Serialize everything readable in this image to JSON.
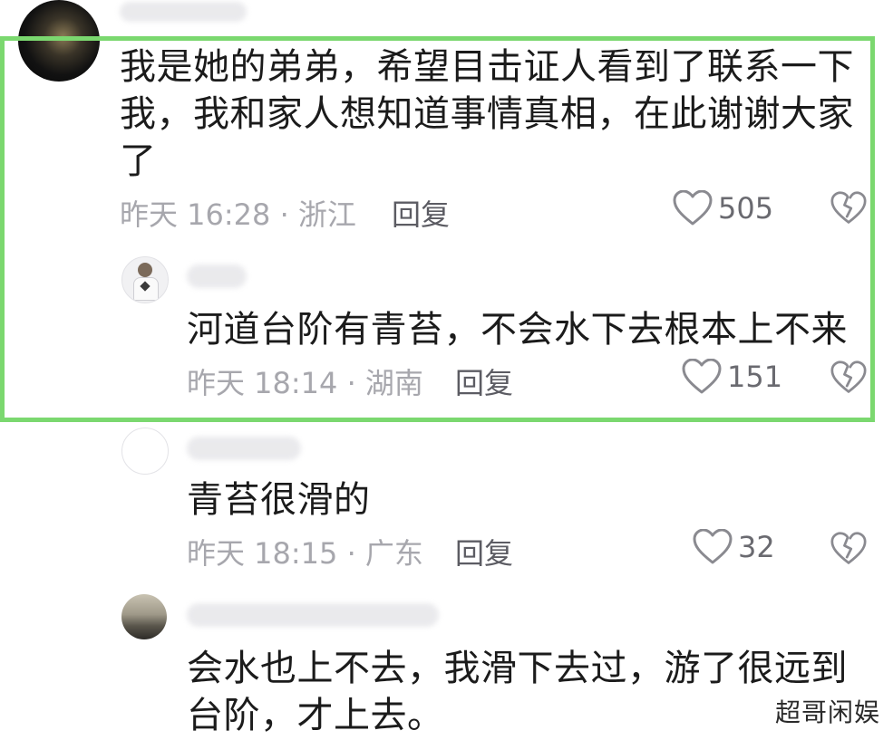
{
  "comments": [
    {
      "text_lines": [
        "我是她的弟弟，希望目击证人看到了联系一下",
        "我，我和家人想知道事情真相，在此谢谢大家",
        "了"
      ],
      "meta": "昨天 16:28 · 浙江",
      "reply": "回复",
      "likes": "505"
    },
    {
      "text_lines": [
        "河道台阶有青苔，不会水下去根本上不来"
      ],
      "meta": "昨天 18:14 · 湖南",
      "reply": "回复",
      "likes": "151"
    },
    {
      "text_lines": [
        "青苔很滑的"
      ],
      "meta": "昨天 18:15 · 广东",
      "reply": "回复",
      "likes": "32"
    },
    {
      "text_lines": [
        "会水也上不去，我滑下去过，游了很远到",
        "台阶，才上去。"
      ]
    }
  ],
  "watermark": "超哥闲娱",
  "colors": {
    "highlight_border": "#7bd86f"
  },
  "icons": [
    "heart-outline-icon",
    "broken-heart-icon"
  ]
}
